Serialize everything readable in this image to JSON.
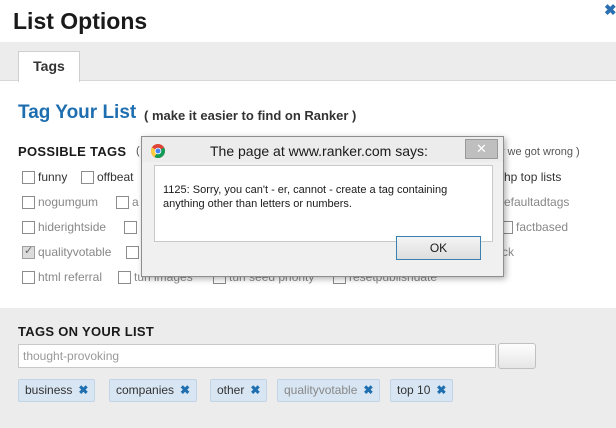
{
  "header": {
    "title": "List Options",
    "close_icon": "close-icon"
  },
  "tabs": [
    {
      "label": "Tags",
      "selected": true
    }
  ],
  "tag_section": {
    "heading": "Tag Your List",
    "subheading": "( make it easier to find on Ranker )",
    "possible_heading": "POSSIBLE TAGS",
    "possible_open_paren": "(",
    "possible_right_text": "y we got wrong )"
  },
  "checkboxes": [
    {
      "label": "funny",
      "checked": false,
      "gray": false
    },
    {
      "label": "offbeat",
      "checked": false,
      "gray": false
    },
    {
      "label": "hp top lists",
      "checked": false,
      "gray": false
    },
    {
      "label": "nogumgum",
      "checked": false,
      "gray": true
    },
    {
      "label": "a",
      "checked": false,
      "gray": true
    },
    {
      "label": "efaultadtags",
      "checked": false,
      "gray": true
    },
    {
      "label": "hiderightside",
      "checked": false,
      "gray": true
    },
    {
      "label": "factbased",
      "checked": false,
      "gray": true
    },
    {
      "label": "qualityvotable",
      "checked": true,
      "gray": true
    },
    {
      "label": "ck",
      "checked": false,
      "gray": true
    },
    {
      "label": "html referral",
      "checked": false,
      "gray": true
    },
    {
      "label": "tun images",
      "checked": false,
      "gray": true
    },
    {
      "label": "tun seed priority",
      "checked": false,
      "gray": true
    },
    {
      "label": "resetpublishdate",
      "checked": false,
      "gray": true
    }
  ],
  "your_tags": {
    "heading": "TAGS ON YOUR LIST",
    "input_value": "thought-provoking",
    "chips": [
      {
        "label": "business",
        "gray": false
      },
      {
        "label": "companies",
        "gray": false
      },
      {
        "label": "other",
        "gray": false
      },
      {
        "label": "qualityvotable",
        "gray": true
      },
      {
        "label": "top 10",
        "gray": false
      }
    ],
    "remove_symbol": "✖"
  },
  "dialog": {
    "title": "The page at www.ranker.com says:",
    "message": "1125: Sorry, you can't - er, cannot - create a tag containing anything other than letters or numbers.",
    "ok_label": "OK",
    "close_symbol": "✕",
    "icon": "chrome-icon"
  },
  "colors": {
    "accent": "#1f6fb0",
    "chip_bg": "#d8e5f2",
    "panel_bg": "#ececec"
  }
}
